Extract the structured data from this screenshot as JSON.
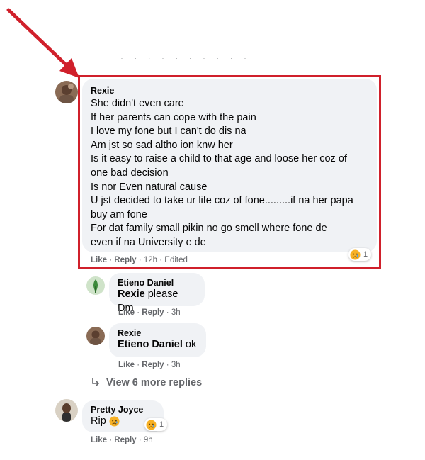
{
  "annotation": {
    "arrow_color": "#d0202b",
    "box_color": "#d0202b"
  },
  "comments": [
    {
      "author": "Rexie",
      "lines": [
        "She didn't even care",
        "If her parents can cope with the pain",
        "I love my fone but I can't do dis na",
        "Am jst so sad altho ion knw her",
        "Is it easy to raise a child to that age and loose her coz of",
        "one bad decision",
        "Is nor Even natural cause",
        "U jst decided to take ur life coz of fone.........if na her papa",
        "buy am fone",
        "For dat family small pikin no go smell where fone de",
        "even if na University e de"
      ],
      "actions": {
        "like": "Like",
        "reply": "Reply",
        "time": "12h",
        "edited": "Edited"
      },
      "reaction": {
        "icon": "sad-emoji-icon",
        "count": "1"
      }
    },
    {
      "author": "Etieno Daniel",
      "mention": "Rexie",
      "text": "please Dm",
      "actions": {
        "like": "Like",
        "reply": "Reply",
        "time": "3h"
      }
    },
    {
      "author": "Rexie",
      "mention": "Etieno Daniel",
      "text": "ok",
      "actions": {
        "like": "Like",
        "reply": "Reply",
        "time": "3h"
      }
    },
    {
      "author": "Pretty Joyce",
      "text": "Rip",
      "emoji": "sad-emoji-icon",
      "actions": {
        "like": "Like",
        "reply": "Reply",
        "time": "9h"
      },
      "reaction": {
        "icon": "sad-emoji-icon",
        "count": "1"
      }
    }
  ],
  "view_more": {
    "label": "View 6 more replies",
    "icon": "reply-arrow-icon"
  },
  "separator": "·"
}
